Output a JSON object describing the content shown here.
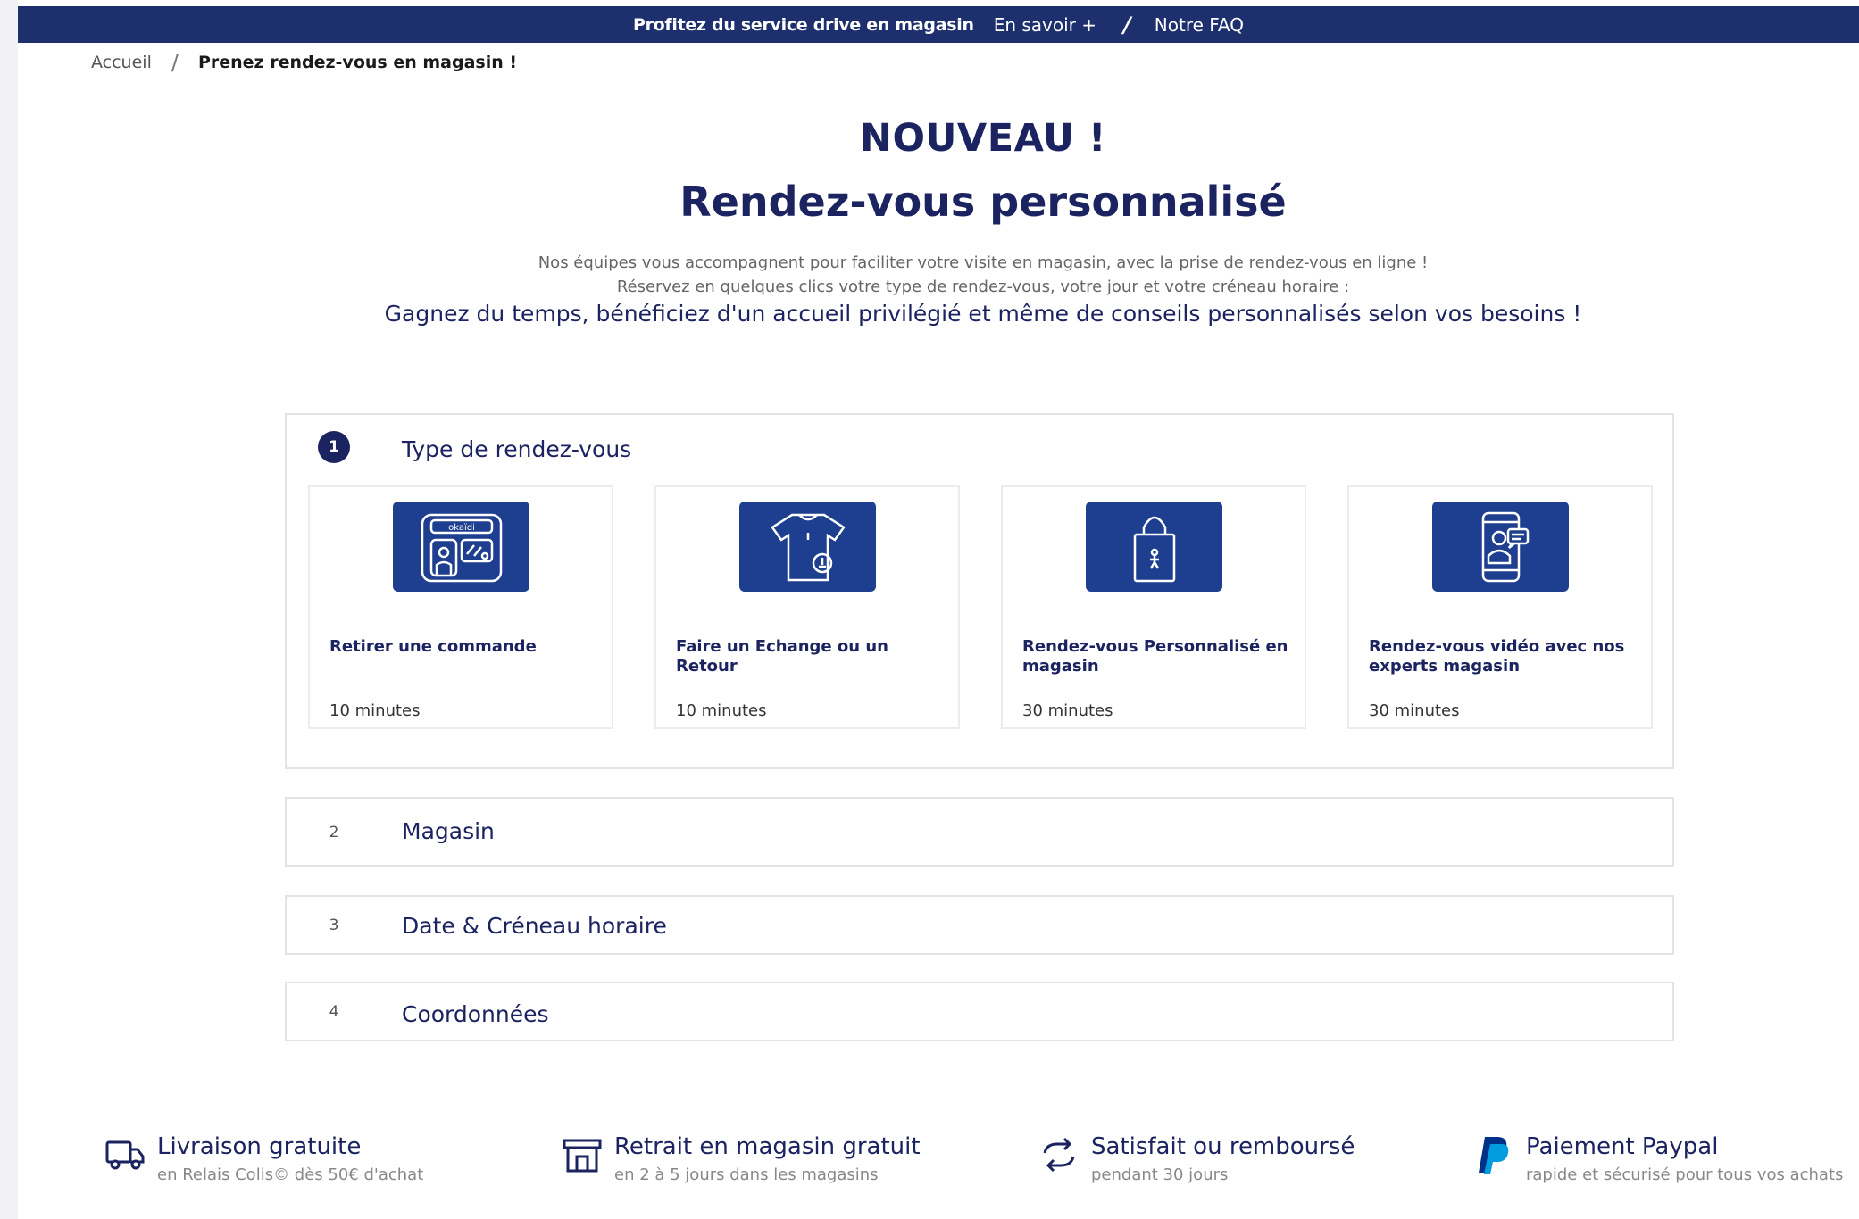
{
  "banner": {
    "promo": "Profitez du service drive en magasin",
    "more_link": "En savoir +",
    "separator": "/",
    "faq_link": "Notre FAQ"
  },
  "breadcrumb": {
    "home": "Accueil",
    "separator": "/",
    "current": "Prenez rendez-vous en magasin !"
  },
  "header": {
    "kicker": "NOUVEAU !",
    "title": "Rendez-vous personnalisé",
    "intro_line1": "Nos équipes vous accompagnent pour faciliter votre visite en magasin, avec la prise de rendez-vous en ligne !",
    "intro_line2": "Réservez en quelques clics votre type de rendez-vous, votre jour et votre créneau horaire :",
    "highlight": "Gagnez du temps, bénéficiez d'un accueil privilégié et même de conseils personnalisés selon vos besoins !"
  },
  "steps": [
    {
      "number": "1",
      "label": "Type de rendez-vous",
      "cards": [
        {
          "title": "Retirer une commande",
          "duration": "10 minutes",
          "icon": "store-pickup-icon",
          "icon_text": "okaïdi"
        },
        {
          "title": "Faire un Echange ou un Retour",
          "duration": "10 minutes",
          "icon": "tshirt-exchange-icon"
        },
        {
          "title": "Rendez-vous Personnalisé en magasin",
          "duration": "30 minutes",
          "icon": "shopping-bag-icon"
        },
        {
          "title": "Rendez-vous vidéo avec nos experts magasin",
          "duration": "30 minutes",
          "icon": "video-call-icon"
        }
      ]
    },
    {
      "number": "2",
      "label": "Magasin"
    },
    {
      "number": "3",
      "label": "Date & Créneau horaire"
    },
    {
      "number": "4",
      "label": "Coordonnées"
    }
  ],
  "features": [
    {
      "title": "Livraison gratuite",
      "subtitle": "en Relais Colis© dès 50€ d'achat",
      "icon": "truck-icon"
    },
    {
      "title": "Retrait en magasin gratuit",
      "subtitle": "en 2 à 5 jours dans les magasins",
      "icon": "store-icon"
    },
    {
      "title": "Satisfait ou remboursé",
      "subtitle": "pendant 30 jours",
      "icon": "refresh-icon"
    },
    {
      "title": "Paiement Paypal",
      "subtitle": "rapide et sécurisé pour tous vos achats",
      "icon": "paypal-icon"
    }
  ],
  "colors": {
    "navy": "#1b2360",
    "banner": "#1e2f6e",
    "icon_box": "#1e3f8f",
    "paypal_dark": "#003087",
    "paypal_light": "#009cde"
  }
}
